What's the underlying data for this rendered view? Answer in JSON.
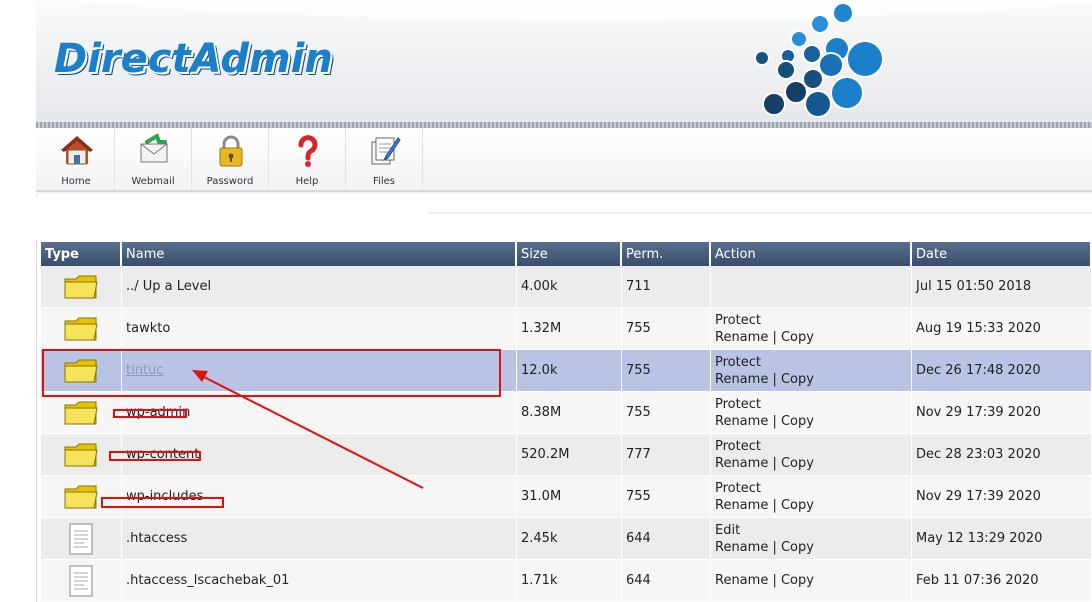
{
  "app": {
    "logo_text": "DirectAdmin"
  },
  "toolbar": [
    {
      "label": "Home",
      "icon": "home-icon"
    },
    {
      "label": "Webmail",
      "icon": "webmail-icon"
    },
    {
      "label": "Password",
      "icon": "padlock-icon"
    },
    {
      "label": "Help",
      "icon": "question-mark-icon"
    },
    {
      "label": "Files",
      "icon": "files-icon"
    }
  ],
  "table": {
    "headers": [
      "Type",
      "Name",
      "Size",
      "Perm.",
      "Action",
      "Date"
    ],
    "rows": [
      {
        "type": "folder",
        "name": "../ Up a Level",
        "size": "4.00k",
        "perm": "711",
        "actions": [],
        "date": "Jul 15 01:50 2018"
      },
      {
        "type": "folder",
        "name": "tawkto",
        "size": "1.32M",
        "perm": "755",
        "actions": [
          "Protect",
          "Rename",
          "Copy"
        ],
        "date": "Aug 19 15:33 2020"
      },
      {
        "type": "folder",
        "name": "tintuc",
        "size": "12.0k",
        "perm": "755",
        "actions": [
          "Protect",
          "Rename",
          "Copy"
        ],
        "date": "Dec 26 17:48 2020",
        "selected": true
      },
      {
        "type": "folder",
        "name": "wp-admin",
        "size": "8.38M",
        "perm": "755",
        "actions": [
          "Protect",
          "Rename",
          "Copy"
        ],
        "date": "Nov 29 17:39 2020"
      },
      {
        "type": "folder",
        "name": "wp-content",
        "size": "520.2M",
        "perm": "777",
        "actions": [
          "Protect",
          "Rename",
          "Copy"
        ],
        "date": "Dec 28 23:03 2020"
      },
      {
        "type": "folder",
        "name": "wp-includes",
        "size": "31.0M",
        "perm": "755",
        "actions": [
          "Protect",
          "Rename",
          "Copy"
        ],
        "date": "Nov 29 17:39 2020"
      },
      {
        "type": "file",
        "name": ".htaccess",
        "size": "2.45k",
        "perm": "644",
        "actions": [
          "Edit",
          "Rename",
          "Copy"
        ],
        "date": "May 12 13:29 2020"
      },
      {
        "type": "file",
        "name": ".htaccess_lscachebak_01",
        "size": "1.71k",
        "perm": "644",
        "actions": [
          "Rename",
          "Copy"
        ],
        "date": "Feb 11 07:36 2020"
      }
    ]
  },
  "colors": {
    "header_bar": "#374f6c",
    "selected_row": "#b9c3e4",
    "annotation": "#e01010",
    "logo": "#1b7fc9"
  }
}
